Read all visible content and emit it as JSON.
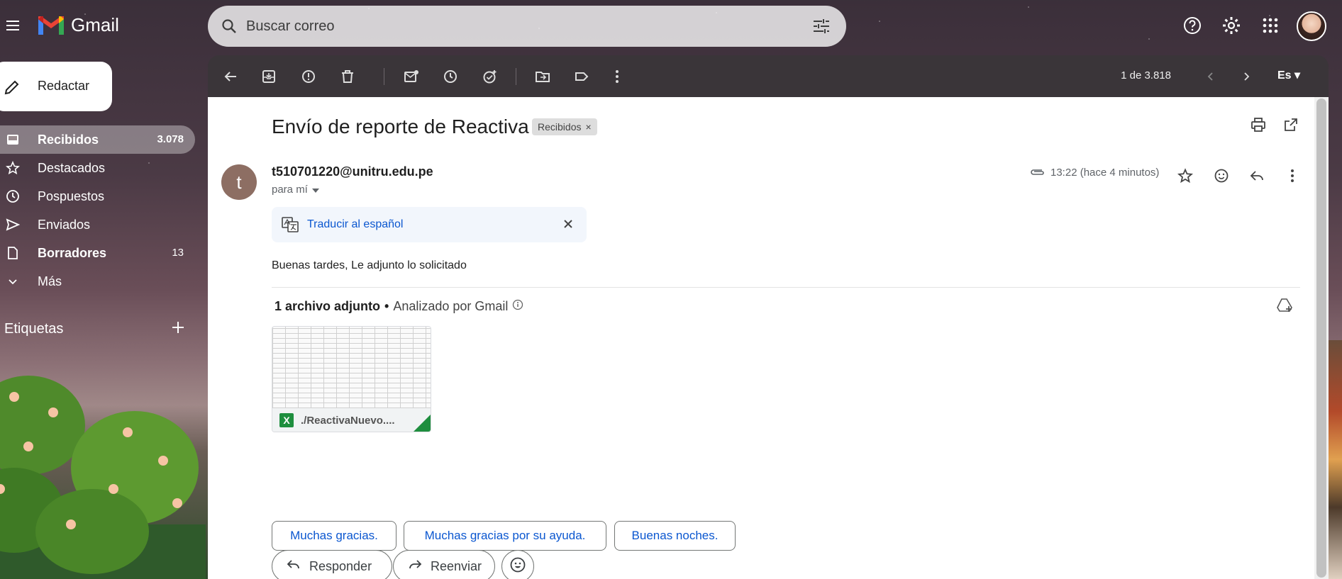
{
  "app": {
    "name": "Gmail"
  },
  "search": {
    "placeholder": "Buscar correo"
  },
  "compose": {
    "label": "Redactar"
  },
  "nav": [
    {
      "label": "Recibidos",
      "count": "3.078",
      "icon": "inbox-icon"
    },
    {
      "label": "Destacados",
      "count": "",
      "icon": "star-icon"
    },
    {
      "label": "Pospuestos",
      "count": "",
      "icon": "clock-icon"
    },
    {
      "label": "Enviados",
      "count": "",
      "icon": "send-icon"
    },
    {
      "label": "Borradores",
      "count": "13",
      "icon": "draft-icon"
    },
    {
      "label": "Más",
      "count": "",
      "icon": "chevron-down-icon"
    }
  ],
  "labels": {
    "heading": "Etiquetas"
  },
  "toolbar": {
    "pager": "1 de 3.818",
    "lang": "Es"
  },
  "email": {
    "subject": "Envío de reporte de Reactiva",
    "chip": "Recibidos",
    "avatar_letter": "t",
    "sender": "t510701220@unitru.edu.pe",
    "to": "para mí",
    "time": "13:22 (hace 4 minutos)",
    "translate": "Traducir al español",
    "body": "Buenas tardes, Le adjunto lo solicitado"
  },
  "attachments": {
    "count_label": "1 archivo adjunto",
    "separator": "•",
    "scanned": "Analizado por Gmail",
    "file_name": "./ReactivaNuevo....",
    "file_type": "X"
  },
  "smart_replies": [
    "Muchas gracias.",
    "Muchas gracias por su ayuda.",
    "Buenas noches."
  ],
  "actions": {
    "reply": "Responder",
    "forward": "Reenviar"
  },
  "colors": {
    "accent": "#0b57d0",
    "toolbar": "#3a3539",
    "excel": "#1e8e3e"
  }
}
